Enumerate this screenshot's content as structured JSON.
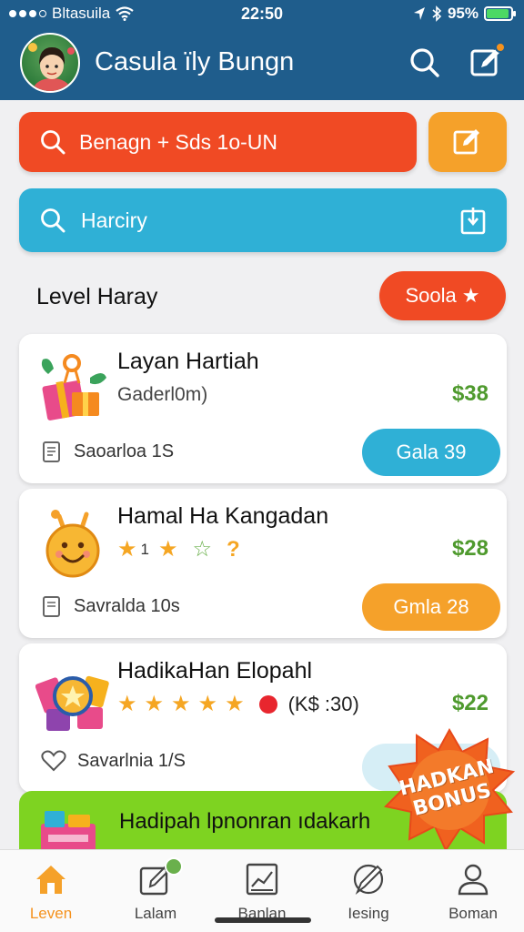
{
  "status_bar": {
    "carrier": "Bltasuila",
    "time": "22:50",
    "battery": "95%"
  },
  "header": {
    "title": "Casula ïly Bungn"
  },
  "search_primary": {
    "text": "Benagn  + Sds 1o-UN"
  },
  "search_secondary": {
    "text": "Harciry"
  },
  "section": {
    "title": "Level Haray",
    "sort_label": "Soola"
  },
  "cards": [
    {
      "title": "Layan Hartiah",
      "subtitle": "Gaderl0m)",
      "price": "$38",
      "meta": "Saoarloa 1S",
      "button": "Gala 39"
    },
    {
      "title": "Hamal Ha Kangadan",
      "star_count": "1",
      "price": "$28",
      "meta": "Savralda 10s",
      "button": "Gmla 28"
    },
    {
      "title": "HadikaHan Elopahl",
      "rating_text": "(K$ :30)",
      "price": "$22",
      "meta": "Savarlnia 1/S"
    }
  ],
  "promo": {
    "text": "Hadipah lpnonran ıdakarh"
  },
  "bonus_badge": {
    "line1": "HADKAN",
    "line2": "BONUS"
  },
  "bottom_nav": [
    {
      "label": "Leven",
      "icon": "home-icon",
      "active": true
    },
    {
      "label": "Lalam",
      "icon": "edit-icon",
      "active": false
    },
    {
      "label": "Banlan",
      "icon": "chart-icon",
      "active": false
    },
    {
      "label": "Iesing",
      "icon": "pencil-icon",
      "active": false
    },
    {
      "label": "Boman",
      "icon": "profile-icon",
      "active": false
    }
  ],
  "colors": {
    "header": "#1f5d8c",
    "orange_red": "#f04a24",
    "orange": "#f5a12a",
    "blue": "#2fb0d6",
    "green_price": "#4f9a2e",
    "promo_green": "#7ed321"
  }
}
